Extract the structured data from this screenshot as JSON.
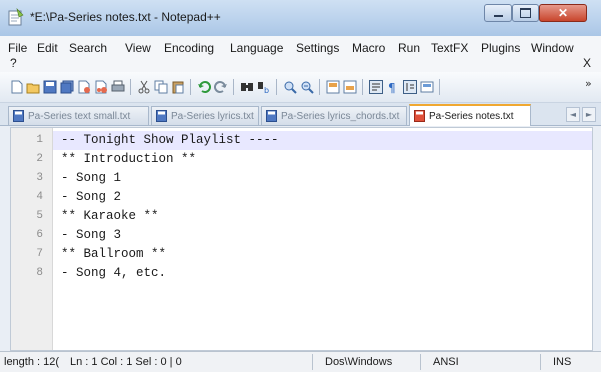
{
  "window": {
    "title": "*E:\\Pa-Series notes.txt - Notepad++"
  },
  "menu": {
    "items": [
      "File",
      "Edit",
      "Search",
      "View",
      "Encoding",
      "Language",
      "Settings",
      "Macro",
      "Run",
      "TextFX",
      "Plugins",
      "Window"
    ],
    "help": "?",
    "close_doc": "X"
  },
  "toolbar": {
    "icons": [
      "new-file-icon",
      "open-file-icon",
      "save-icon",
      "save-all-icon",
      "close-icon",
      "close-all-icon",
      "print-icon",
      "cut-icon",
      "copy-icon",
      "paste-icon",
      "undo-icon",
      "redo-icon",
      "find-icon",
      "replace-icon",
      "zoom-in-icon",
      "zoom-out-icon",
      "sync-vertical-icon",
      "sync-horizontal-icon",
      "word-wrap-icon",
      "show-all-chars-icon",
      "indent-guide-icon",
      "macro-icon"
    ],
    "more": "»"
  },
  "tabs": [
    {
      "label": "Pa-Series text small.txt",
      "active": false
    },
    {
      "label": "Pa-Series lyrics.txt",
      "active": false
    },
    {
      "label": "Pa-Series lyrics_chords.txt",
      "active": false
    },
    {
      "label": "Pa-Series notes.txt",
      "active": true
    }
  ],
  "tab_nav": {
    "left": "◄",
    "right": "►"
  },
  "editor": {
    "lines": [
      {
        "num": "1",
        "text": "-- Tonight Show Playlist ----"
      },
      {
        "num": "2",
        "text": "** Introduction **"
      },
      {
        "num": "3",
        "text": "- Song 1"
      },
      {
        "num": "4",
        "text": "- Song 2"
      },
      {
        "num": "5",
        "text": "** Karaoke **"
      },
      {
        "num": "6",
        "text": "- Song 3"
      },
      {
        "num": "7",
        "text": "** Ballroom **"
      },
      {
        "num": "8",
        "text": "- Song 4, etc."
      }
    ]
  },
  "status": {
    "length": "length : 12(",
    "position": "Ln : 1    Col : 1    Sel : 0 | 0",
    "eol": "Dos\\Windows",
    "encoding": "ANSI",
    "mode": "INS"
  },
  "colors": {
    "current_line": "#e8e8ff",
    "active_tab_accent": "#f0a830",
    "close_button": "#c8452c"
  }
}
